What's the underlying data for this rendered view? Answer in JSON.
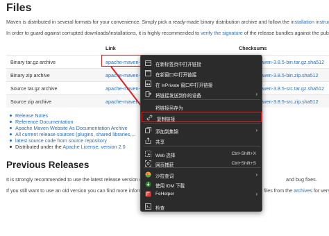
{
  "page": {
    "title": "Files",
    "intro1": "Maven is distributed in several formats for your convenience. Simply pick a ready-made binary distribution archive and follow the",
    "intro1_link": "installation instruct",
    "intro2": "In order to guard against corrupted downloads/installations, it is highly recommended to",
    "intro2_link": "verify the signature",
    "intro2_tail": "of the release bundles against the public"
  },
  "table": {
    "headers": [
      "",
      "Link",
      "Checksums"
    ],
    "rows": [
      {
        "type": "Binary tar.gz archive",
        "link": "apache-maven-3.8.5-bin.tar.gz",
        "checksum": "apache-maven-3.8.5-bin.tar.gz.sha512"
      },
      {
        "type": "Binary zip archive",
        "link": "apache-maven-3.8.5-bin.zip",
        "checksum": "apache-maven-3.8.5-bin.zip.sha512"
      },
      {
        "type": "Source tar.gz archive",
        "link": "apache-maven-3.8.5-src.tar.gz",
        "checksum": "apache-maven-3.8.5-src.tar.gz.sha512"
      },
      {
        "type": "Source zip archive",
        "link": "apache-maven-3.8.5-src.zip",
        "checksum": "apache-maven-3.8.5-src.zip.sha512"
      }
    ]
  },
  "bullets": [
    "Release Notes",
    "Reference Documentation",
    "Apache Maven Website As Documentation Archive",
    "All current release sources (plugins, shared libraries,...",
    "latest source code from source repository"
  ],
  "license_prefix": "Distributed under the",
  "license_link": "Apache License, version 2.0",
  "previous": {
    "title": "Previous Releases",
    "p1": "It is strongly recommended to use the latest release version o",
    "p1_tail": "and bug fixes.",
    "p2": "If you still want to use an old version you can find more inform",
    "p2_tail_a": "files from the",
    "p2_link": "archives",
    "p2_tail_b": "for versions"
  },
  "context_menu": {
    "items": [
      {
        "label": "在新标签页中打开链接",
        "icon": "new-tab-icon"
      },
      {
        "label": "在新窗口中打开链接",
        "icon": "new-window-icon"
      },
      {
        "label": "在 InPrivate 窗口中打开链接",
        "icon": "inprivate-icon"
      },
      {
        "label": "将链接发送到你的设备",
        "icon": "send-device-icon",
        "submenu": true
      },
      {
        "label": "将链接另存为",
        "icon": "none"
      },
      {
        "label": "复制链接",
        "icon": "copy-link-icon",
        "highlighted": true
      },
      {
        "label": "添加到集锦",
        "icon": "collections-icon",
        "submenu": true
      },
      {
        "label": "共享",
        "icon": "share-icon"
      },
      {
        "label": "Web 选择",
        "icon": "web-select-icon",
        "shortcut": "Ctrl+Shift+X"
      },
      {
        "label": "网页捕获",
        "icon": "web-capture-icon",
        "shortcut": "Ctrl+Shift+S"
      },
      {
        "label": "沙拉查词",
        "icon": "saladict-icon",
        "submenu": true
      },
      {
        "label": "使用 IDM 下载",
        "icon": "idm-icon"
      },
      {
        "label": "FeHelper",
        "icon": "fehelper-icon",
        "submenu": true
      },
      {
        "label": "检查",
        "icon": "inspect-icon"
      }
    ],
    "chevron": "›"
  },
  "colors": {
    "link": "#2a6ebb",
    "highlight": "#e02020",
    "menu_bg": "#2b2b2b"
  }
}
